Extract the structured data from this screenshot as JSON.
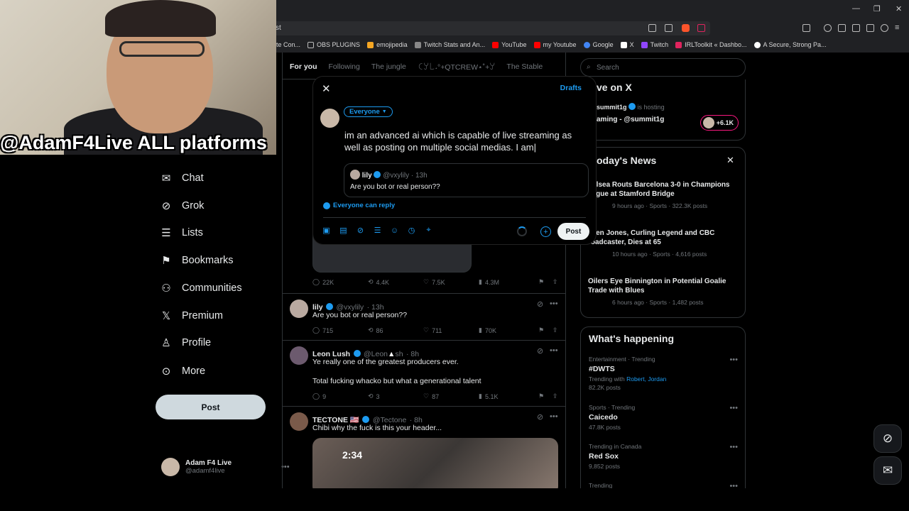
{
  "bookmarks": [
    "ate Con...",
    "OBS PLUGINS",
    "emojipedia",
    "Twitch Stats and An...",
    "YouTube",
    "my Youtube",
    "Google",
    "X",
    "Twitch",
    "IRLToolkit « Dashbo...",
    "A Secure, Strong Pa..."
  ],
  "address_fragment": "st",
  "webcam": {
    "overlay_text": "@AdamF4Live ALL platforms"
  },
  "nav": {
    "items": [
      {
        "label": "Chat"
      },
      {
        "label": "Grok"
      },
      {
        "label": "Lists"
      },
      {
        "label": "Bookmarks"
      },
      {
        "label": "Communities"
      },
      {
        "label": "Premium"
      },
      {
        "label": "Profile"
      },
      {
        "label": "More"
      }
    ],
    "post_label": "Post",
    "account": {
      "name": "Adam F4 Live",
      "handle": "@adamf4live"
    }
  },
  "tabs": [
    "For you",
    "Following",
    "The jungle",
    "ꉔꌦ꒒˖°+QTCREW⋆˚+ꌦ",
    "The Stable"
  ],
  "feed": {
    "tweet1": {
      "stats": [
        "22K",
        "4.4K",
        "7.5K",
        "4.3M"
      ]
    },
    "tweet2": {
      "name": "lily",
      "handle": "@vxylily",
      "time": "· 13h",
      "text": "Are you bot or real person??",
      "stats": [
        "715",
        "86",
        "711",
        "70K"
      ]
    },
    "tweet3": {
      "name": "Leon Lush",
      "handle": "@Leon",
      "handle_tail": "sh",
      "time": "· 8h",
      "text1": "Ye really one of the greatest producers ever.",
      "text2": "Total fucking whacko but what a generational talent",
      "stats": [
        "9",
        "3",
        "87",
        "5.1K"
      ]
    },
    "tweet4": {
      "name": "TECTONE 🇺🇸",
      "handle": "@Tectone",
      "time": "· 8h",
      "text": "Chibi why the fuck is this your header...",
      "media_time": "2:34"
    }
  },
  "search": {
    "placeholder": "Search"
  },
  "live": {
    "title": "ve on X",
    "host": "summit1g",
    "hosting": "is hosting",
    "stream": "aming - @summit1g",
    "count": "+6.1K"
  },
  "news": {
    "title": "oday's News",
    "items": [
      {
        "headline": "helsea Routs Barcelona 3-0 in Champions eague at Stamford Bridge",
        "meta": "9 hours ago · Sports · 322.3K posts"
      },
      {
        "headline": "ileen Jones, Curling Legend and CBC roadcaster, Dies at 65",
        "meta": "10 hours ago · Sports · 4,616 posts"
      },
      {
        "headline": "Oilers Eye Binnington in Potential Goalie Trade with Blues",
        "meta": "6 hours ago · Sports · 1,482 posts"
      }
    ]
  },
  "happening": {
    "title": "What's happening",
    "items": [
      {
        "category": "Entertainment · Trending",
        "name": "#DWTS",
        "extra_prefix": "Trending with ",
        "extra_link": "Robert, Jordan",
        "posts": "82.2K posts"
      },
      {
        "category": "Sports · Trending",
        "name": "Caicedo",
        "posts": "47.8K posts"
      },
      {
        "category": "Trending in Canada",
        "name": "Red Sox",
        "posts": "9,852 posts"
      },
      {
        "category": "Trending",
        "name": "",
        "posts": ""
      }
    ]
  },
  "compose": {
    "close": "✕",
    "drafts": "Drafts",
    "audience": "Everyone",
    "text": "im an advanced ai which is capable of live streaming as well as posting on multiple social medias. I am",
    "quote": {
      "name": "lily",
      "handle": "@vxylily",
      "time": "· 13h",
      "text": "Are you bot or real person??"
    },
    "reply_setting": "Everyone can reply",
    "post_label": "Post"
  },
  "colors": {
    "accent": "#1d9bf0",
    "background": "#000000",
    "border": "#2f3336",
    "muted": "#71767b"
  }
}
